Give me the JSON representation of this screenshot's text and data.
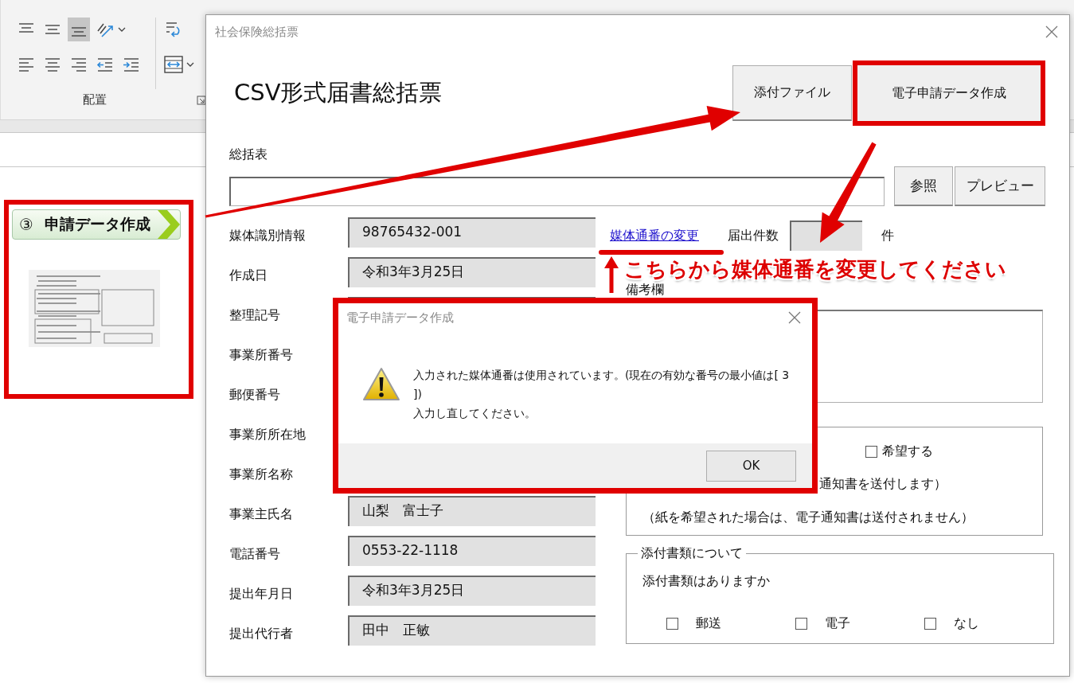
{
  "ribbon": {
    "rows": [
      {
        "buttons": [
          {
            "kind": "align-top",
            "selected": false,
            "dropdown": false
          },
          {
            "kind": "align-middle",
            "selected": false,
            "dropdown": false
          },
          {
            "kind": "align-bottom",
            "selected": true,
            "dropdown": false
          },
          {
            "kind": "orientation",
            "selected": false,
            "dropdown": true
          }
        ]
      },
      {
        "buttons": [
          {
            "kind": "align-left",
            "selected": false,
            "dropdown": false
          },
          {
            "kind": "align-center",
            "selected": false,
            "dropdown": false
          },
          {
            "kind": "align-right",
            "selected": false,
            "dropdown": false
          },
          {
            "kind": "indent-decrease",
            "selected": false,
            "dropdown": false
          },
          {
            "kind": "indent-increase",
            "selected": false,
            "dropdown": false
          }
        ]
      }
    ],
    "side_buttons": [
      {
        "kind": "wrap",
        "selected": false,
        "dropdown": false
      },
      {
        "kind": "merge",
        "selected": false,
        "dropdown": true
      }
    ],
    "group_label": "配置"
  },
  "step_card": {
    "number": "③",
    "title": "申請データ作成"
  },
  "main_window": {
    "title": "社会保険総括票",
    "heading": "CSV形式届書総括票",
    "buttons": [
      {
        "label": "添付ファイル",
        "highlighted": false
      },
      {
        "label": "電子申請データ作成",
        "highlighted": true
      }
    ],
    "summary_label": "総括表",
    "summary_buttons": [
      "参照",
      "プレビュー"
    ],
    "fields": [
      {
        "label": "媒体識別情報",
        "value": "98765432-001"
      },
      {
        "label": "作成日",
        "value": "令和3年3月25日"
      },
      {
        "label": "整理記号"
      },
      {
        "label": "事業所番号"
      },
      {
        "label": "郵便番号"
      },
      {
        "label": "事業所所在地"
      },
      {
        "label": "事業所名称"
      },
      {
        "label": "事業主氏名",
        "value": "山梨　富士子"
      },
      {
        "label": "電話番号",
        "value": "0553-22-1118"
      },
      {
        "label": "提出年月日",
        "value": "令和3年3月25日"
      },
      {
        "label": "提出代行者",
        "value": "田中　正敏"
      }
    ],
    "media_link": "媒体通番の変更",
    "count_label": "届出件数",
    "count_unit": "件",
    "remarks_label": "備考欄",
    "notice_group": {
      "checkbox": {
        "label": "希望する",
        "checked": false
      },
      "lines": [
        "通知書を送付します）",
        "（紙を希望された場合は、電子通知書は送付されません）"
      ]
    },
    "attachments_group": {
      "title": "添付書類について",
      "question": "添付書類はありますか",
      "options": [
        {
          "label": "郵送",
          "checked": false
        },
        {
          "label": "電子",
          "checked": false
        },
        {
          "label": "なし",
          "checked": false
        }
      ]
    }
  },
  "annotation": "こちらから媒体通番を変更してください",
  "message_box": {
    "title": "電子申請データ作成",
    "message_lines": [
      "入力された媒体通番は使用されています。(現在の有効な番号の最小値は[ 3 ])",
      "入力し直してください。"
    ],
    "button": "OK"
  }
}
